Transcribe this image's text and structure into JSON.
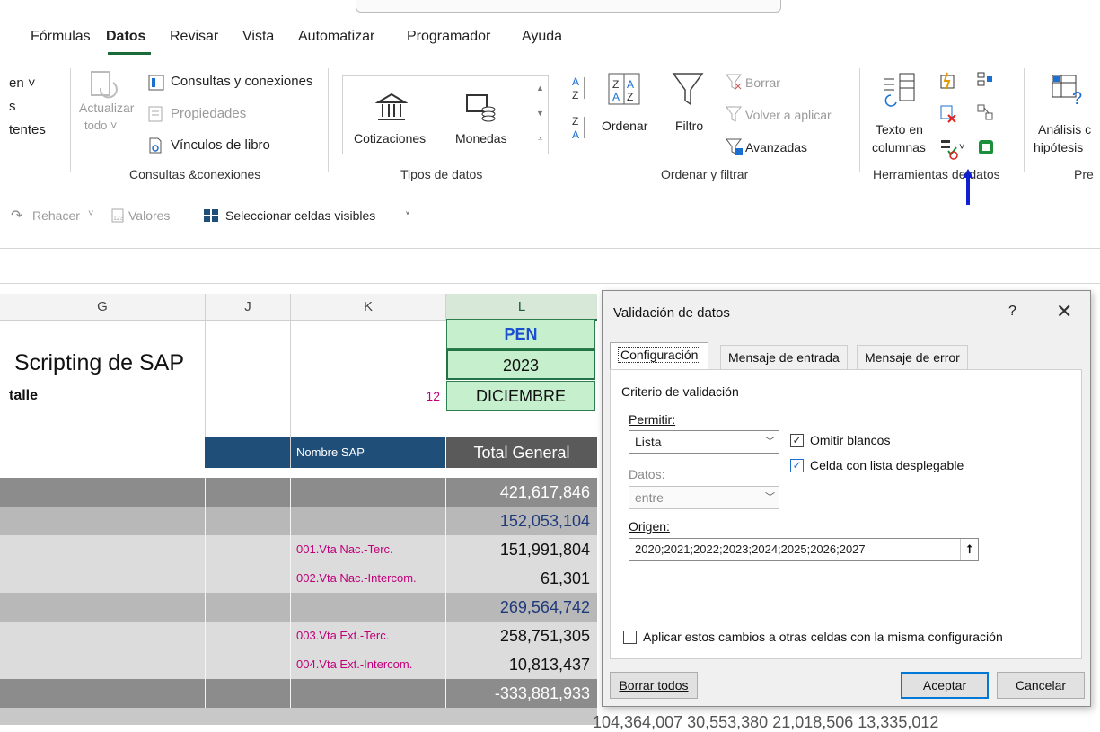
{
  "ribbon_tabs": [
    "Fórmulas",
    "Datos",
    "Revisar",
    "Vista",
    "Automatizar",
    "Programador",
    "Ayuda"
  ],
  "ribbon": {
    "left_partial": [
      "en ˅",
      "s",
      "tentes"
    ],
    "queries": {
      "refresh_label_1": "Actualizar",
      "refresh_label_2": "todo ˅",
      "consultas": "Consultas y conexiones",
      "propiedades": "Propiedades",
      "vinculos": "Vínculos de libro",
      "group": "Consultas &conexiones"
    },
    "datatypes": {
      "cotizaciones": "Cotizaciones",
      "monedas": "Monedas",
      "group": "Tipos de datos"
    },
    "sort": {
      "ordenar": "Ordenar",
      "filtro": "Filtro",
      "borrar": "Borrar",
      "volver": "Volver a aplicar",
      "avanzadas": "Avanzadas",
      "group": "Ordenar y filtrar"
    },
    "tools": {
      "texto1": "Texto en",
      "texto2": "columnas",
      "group": "Herramientas de datos"
    },
    "whatif": {
      "l1": "Análisis c",
      "l2": "hipótesis",
      "group": "Pre"
    }
  },
  "quickbar": {
    "rehacer": "Rehacer",
    "valores": "Valores",
    "seleccionar": "Seleccionar celdas visibles"
  },
  "columns": [
    "G",
    "J",
    "K",
    "L"
  ],
  "sheet": {
    "title": "Scripting de SAP",
    "subtitle": "talle",
    "k_num": "12",
    "cells_L": [
      "PEN",
      "2023",
      "DICIEMBRE"
    ],
    "hdr_k": "Nombre SAP",
    "hdr_l": "Total General",
    "rows": [
      {
        "label": "",
        "value": "421,617,846",
        "style": "dark"
      },
      {
        "label": "",
        "value": "152,053,104",
        "style": "mid"
      },
      {
        "label": "001.Vta Nac.-Terc.",
        "value": "151,991,804",
        "style": "light"
      },
      {
        "label": "002.Vta Nac.-Intercom.",
        "value": "61,301",
        "style": "light"
      },
      {
        "label": "",
        "value": "269,564,742",
        "style": "mid"
      },
      {
        "label": "003.Vta Ext.-Terc.",
        "value": "258,751,305",
        "style": "light"
      },
      {
        "label": "004.Vta Ext.-Intercom.",
        "value": "10,813,437",
        "style": "light"
      },
      {
        "label": "",
        "value": "-333,881,933",
        "style": "dark"
      }
    ],
    "bottom_partial": "104,364,007          30,553,380          21,018,506          13,335,012"
  },
  "dialog": {
    "title": "Validación de datos",
    "help": "?",
    "close": "✕",
    "tabs": [
      "Configuración",
      "Mensaje de entrada",
      "Mensaje de error"
    ],
    "section": "Criterio de validación",
    "permitir_label": "Permitir:",
    "permitir_value": "Lista",
    "datos_label": "Datos:",
    "datos_value": "entre",
    "omitir": "Omitir blancos",
    "celda_lista": "Celda con lista desplegable",
    "origen_label": "Origen:",
    "origen_value": "2020;2021;2022;2023;2024;2025;2026;2027",
    "aplicar": "Aplicar estos cambios a otras celdas con la misma configuración",
    "borrar": "Borrar todos",
    "aceptar": "Aceptar",
    "cancelar": "Cancelar"
  },
  "colors": {
    "accent_green": "#217346",
    "arrow_blue": "#1020d0",
    "header_navy": "#1f4e79",
    "cell_green": "#c6efce"
  }
}
